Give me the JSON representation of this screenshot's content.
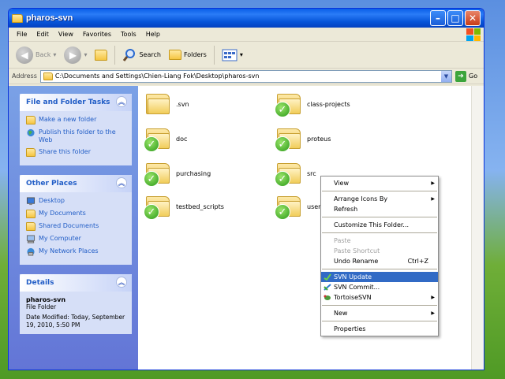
{
  "window": {
    "title": "pharos-svn"
  },
  "menu": [
    "File",
    "Edit",
    "View",
    "Favorites",
    "Tools",
    "Help"
  ],
  "toolbar": {
    "back": "Back",
    "search": "Search",
    "folders": "Folders"
  },
  "address": {
    "label": "Address",
    "path": "C:\\Documents and Settings\\Chien-Liang Fok\\Desktop\\pharos-svn",
    "go": "Go"
  },
  "tasks": {
    "file_folder": {
      "title": "File and Folder Tasks",
      "items": [
        "Make a new folder",
        "Publish this folder to the Web",
        "Share this folder"
      ]
    },
    "other_places": {
      "title": "Other Places",
      "items": [
        "Desktop",
        "My Documents",
        "Shared Documents",
        "My Computer",
        "My Network Places"
      ]
    },
    "details": {
      "title": "Details",
      "name": "pharos-svn",
      "type": "File Folder",
      "modified": "Date Modified: Today, September 19, 2010, 5:50 PM"
    }
  },
  "files": [
    {
      "name": ".svn",
      "svn": false
    },
    {
      "name": "class-projects",
      "svn": true
    },
    {
      "name": "doc",
      "svn": true
    },
    {
      "name": "proteus",
      "svn": true
    },
    {
      "name": "purchasing",
      "svn": true
    },
    {
      "name": "src",
      "svn": true
    },
    {
      "name": "testbed_scripts",
      "svn": true
    },
    {
      "name": "user",
      "svn": true
    }
  ],
  "context_menu": {
    "view": "View",
    "arrange": "Arrange Icons By",
    "refresh": "Refresh",
    "customize": "Customize This Folder...",
    "paste": "Paste",
    "paste_shortcut": "Paste Shortcut",
    "undo": "Undo Rename",
    "undo_shortcut": "Ctrl+Z",
    "svn_update": "SVN Update",
    "svn_commit": "SVN Commit...",
    "tortoise": "TortoiseSVN",
    "new": "New",
    "properties": "Properties"
  }
}
